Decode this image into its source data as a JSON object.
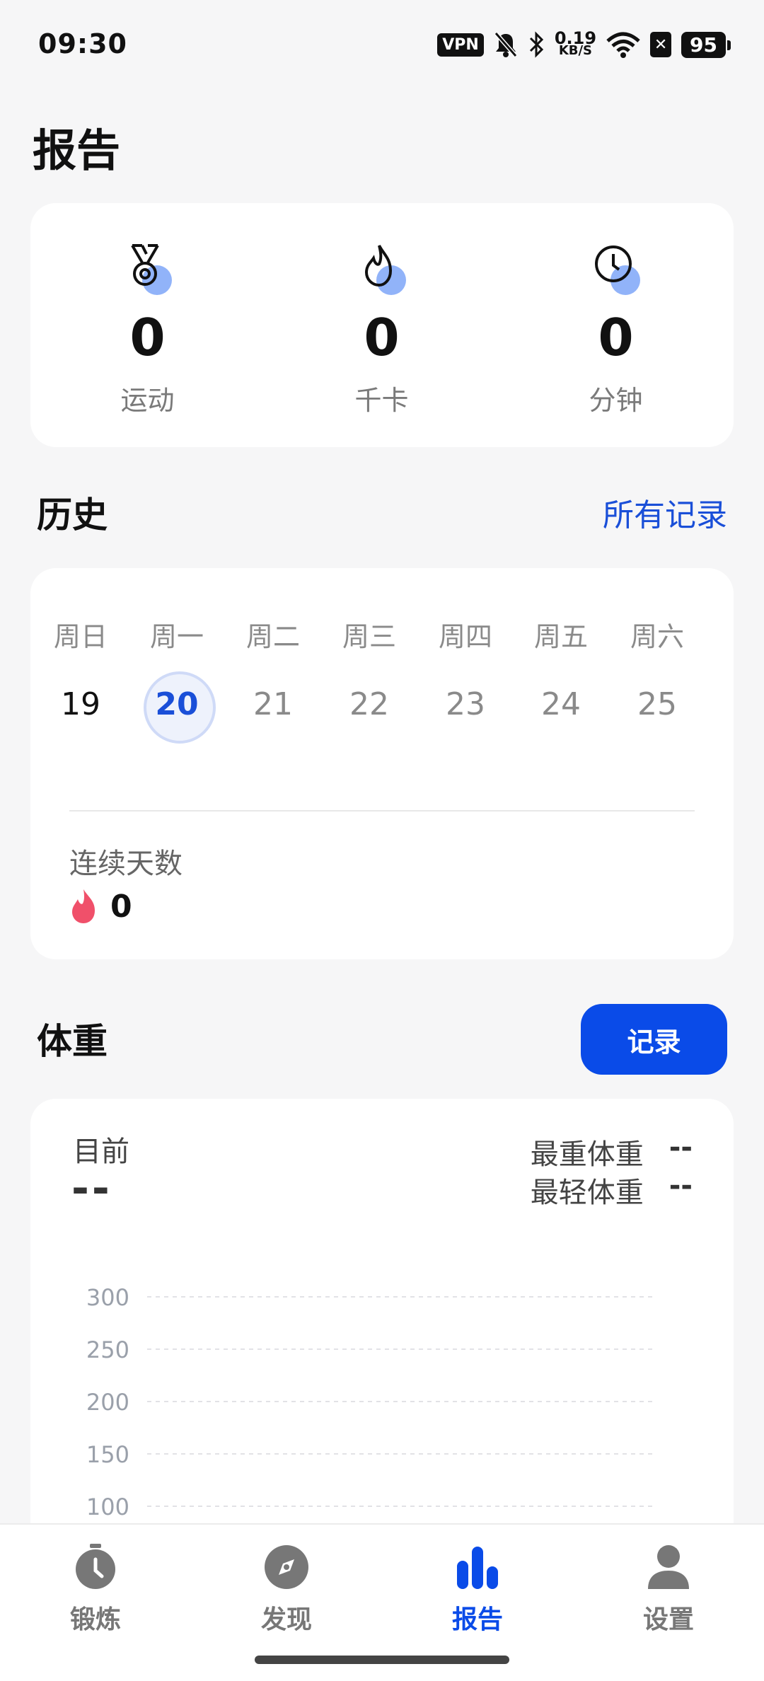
{
  "status_bar": {
    "time": "09:30",
    "vpn": "VPN",
    "net_speed": "0.19",
    "net_unit": "KB/S",
    "battery": "95"
  },
  "page": {
    "title": "报告"
  },
  "summary": [
    {
      "icon": "medal-icon",
      "value": "0",
      "label": "运动"
    },
    {
      "icon": "flame-icon",
      "value": "0",
      "label": "千卡"
    },
    {
      "icon": "clock-icon",
      "value": "0",
      "label": "分钟"
    }
  ],
  "history": {
    "title": "历史",
    "all_records": "所有记录",
    "weekdays": [
      "周日",
      "周一",
      "周二",
      "周三",
      "周四",
      "周五",
      "周六"
    ],
    "dates": [
      "19",
      "20",
      "21",
      "22",
      "23",
      "24",
      "25"
    ],
    "today_index": 1,
    "streak_label": "连续天数",
    "streak_value": "0"
  },
  "weight": {
    "title": "体重",
    "record_button": "记录",
    "current_label": "目前",
    "current_value": "--",
    "max_label": "最重体重",
    "max_value": "--",
    "min_label": "最轻体重",
    "min_value": "--"
  },
  "chart_data": {
    "type": "line",
    "y_ticks": [
      300,
      250,
      200,
      150,
      100
    ],
    "series": [],
    "grid": "dashed horizontal"
  },
  "nav": [
    {
      "icon": "stopwatch-icon",
      "label": "锻炼"
    },
    {
      "icon": "compass-icon",
      "label": "发现"
    },
    {
      "icon": "bar-chart-icon",
      "label": "报告"
    },
    {
      "icon": "person-icon",
      "label": "设置"
    }
  ],
  "colors": {
    "accent": "#0a4be8",
    "link": "#1a4fd8",
    "flame": "#f0506a"
  }
}
